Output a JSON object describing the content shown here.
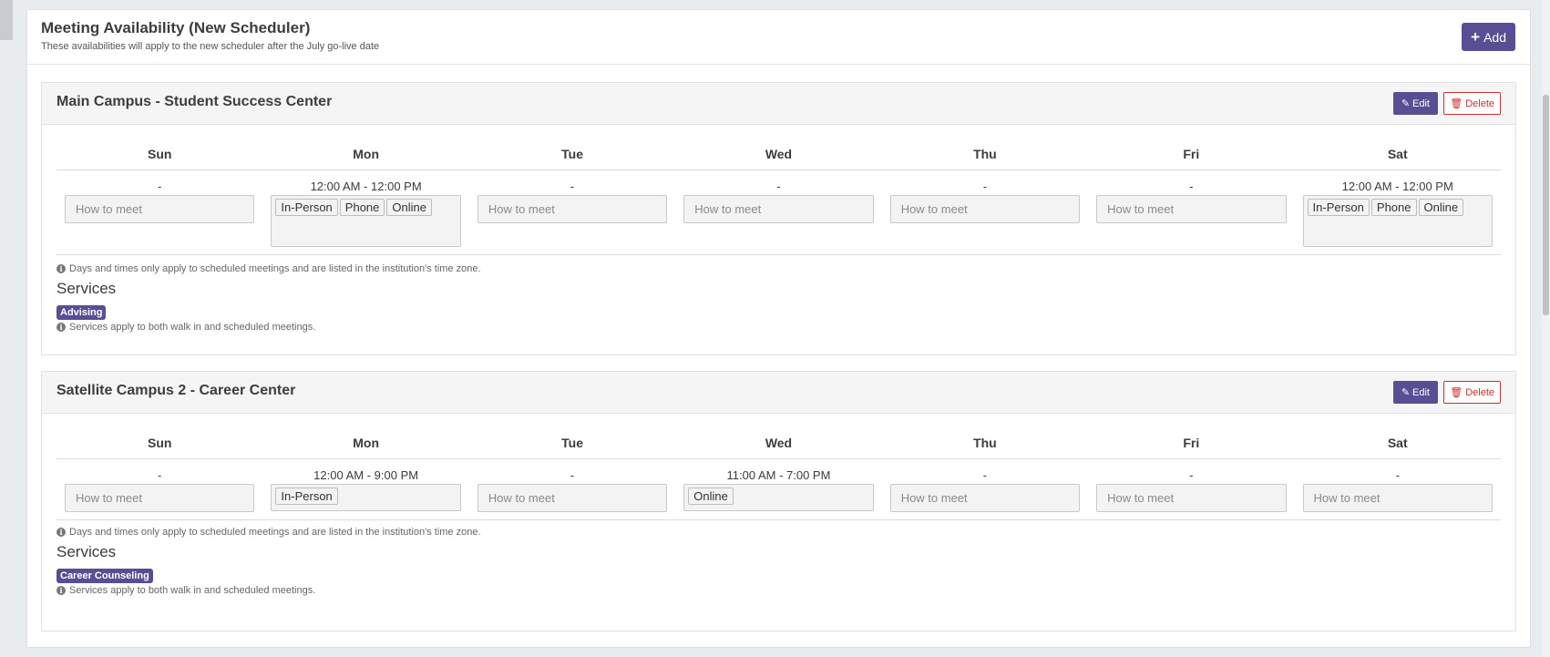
{
  "panel": {
    "title": "Meeting Availability (New Scheduler)",
    "subtitle": "These availabilities will apply to the new scheduler after the July go-live date",
    "add_label": "Add"
  },
  "locations": [
    {
      "name": "Main Campus - Student Success Center",
      "edit_label": "Edit",
      "delete_label": "Delete",
      "days": [
        {
          "day": "Sun",
          "time": "-",
          "methods": [],
          "placeholder": "How to meet"
        },
        {
          "day": "Mon",
          "time": "12:00 AM - 12:00 PM",
          "methods": [
            "In-Person",
            "Phone",
            "Online"
          ],
          "placeholder": ""
        },
        {
          "day": "Tue",
          "time": "-",
          "methods": [],
          "placeholder": "How to meet"
        },
        {
          "day": "Wed",
          "time": "-",
          "methods": [],
          "placeholder": "How to meet"
        },
        {
          "day": "Thu",
          "time": "-",
          "methods": [],
          "placeholder": "How to meet"
        },
        {
          "day": "Fri",
          "time": "-",
          "methods": [],
          "placeholder": "How to meet"
        },
        {
          "day": "Sat",
          "time": "12:00 AM - 12:00 PM",
          "methods": [
            "In-Person",
            "Phone",
            "Online"
          ],
          "placeholder": ""
        }
      ],
      "timezone_note": "Days and times only apply to scheduled meetings and are listed in the institution's time zone.",
      "services_title": "Services",
      "services": [
        "Advising"
      ],
      "services_note": "Services apply to both walk in and scheduled meetings."
    },
    {
      "name": "Satellite Campus 2 - Career Center",
      "edit_label": "Edit",
      "delete_label": "Delete",
      "days": [
        {
          "day": "Sun",
          "time": "-",
          "methods": [],
          "placeholder": "How to meet"
        },
        {
          "day": "Mon",
          "time": "12:00 AM - 9:00 PM",
          "methods": [
            "In-Person"
          ],
          "placeholder": ""
        },
        {
          "day": "Tue",
          "time": "-",
          "methods": [],
          "placeholder": "How to meet"
        },
        {
          "day": "Wed",
          "time": "11:00 AM - 7:00 PM",
          "methods": [
            "Online"
          ],
          "placeholder": ""
        },
        {
          "day": "Thu",
          "time": "-",
          "methods": [],
          "placeholder": "How to meet"
        },
        {
          "day": "Fri",
          "time": "-",
          "methods": [],
          "placeholder": "How to meet"
        },
        {
          "day": "Sat",
          "time": "-",
          "methods": [],
          "placeholder": "How to meet"
        }
      ],
      "timezone_note": "Days and times only apply to scheduled meetings and are listed in the institution's time zone.",
      "services_title": "Services",
      "services": [
        "Career Counseling"
      ],
      "services_note": "Services apply to both walk in and scheduled meetings."
    }
  ],
  "icons": {
    "add": "plus-icon",
    "edit": "pencil-icon",
    "delete": "trash-icon",
    "info": "info-circle-icon"
  },
  "colors": {
    "primary": "#574e93",
    "danger": "#c9302c"
  }
}
